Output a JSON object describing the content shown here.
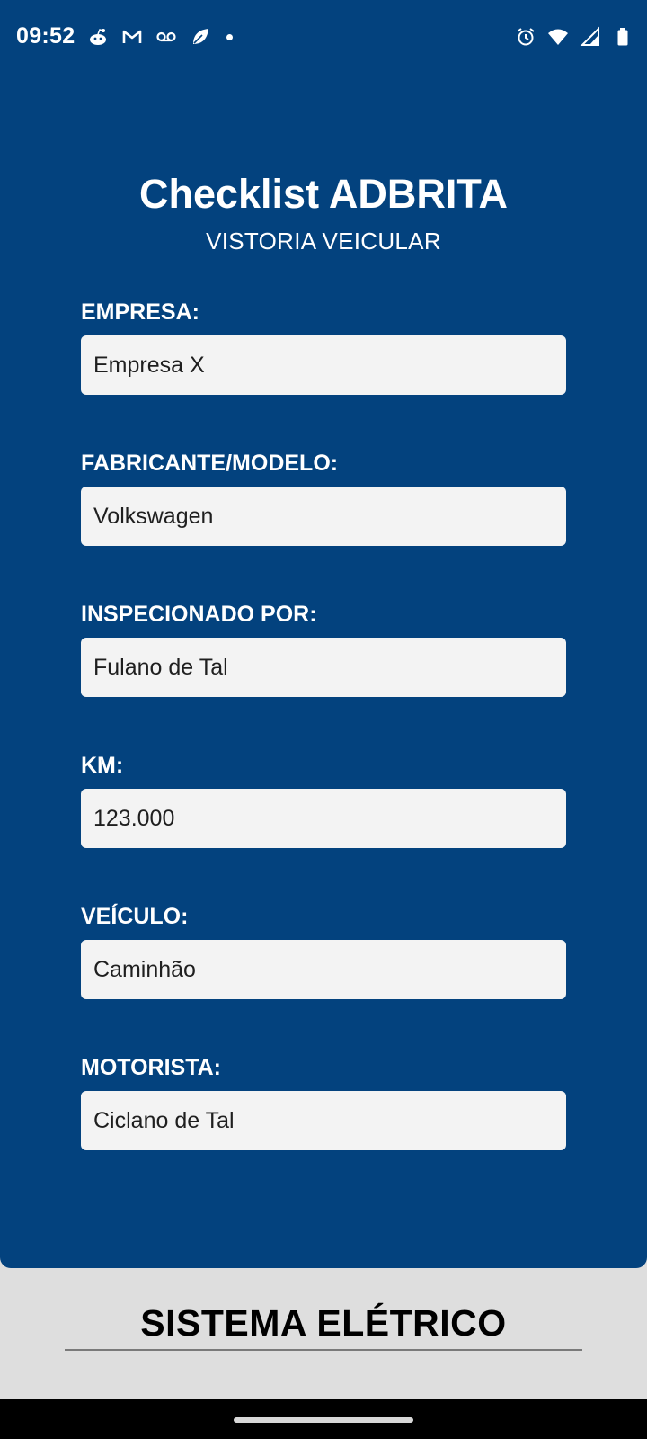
{
  "status_bar": {
    "time": "09:52",
    "left_icons": [
      "reddit-icon",
      "gmail-icon",
      "voicemail-icon",
      "leaf-icon",
      "notification-dot"
    ],
    "right_icons": [
      "alarm-icon",
      "wifi-icon",
      "signal-icon",
      "battery-icon"
    ]
  },
  "header": {
    "title": "Checklist ADBRITA",
    "subtitle": "VISTORIA VEICULAR"
  },
  "form": {
    "empresa": {
      "label": "EMPRESA:",
      "value": "Empresa X"
    },
    "fabricante": {
      "label": "FABRICANTE/MODELO:",
      "value": "Volkswagen"
    },
    "inspecionado": {
      "label": "INSPECIONADO POR:",
      "value": "Fulano de Tal"
    },
    "km": {
      "label": "KM:",
      "value": "123.000"
    },
    "veiculo": {
      "label": "VEÍCULO:",
      "value": "Caminhão"
    },
    "motorista": {
      "label": "MOTORISTA:",
      "value": "Ciclano de Tal"
    }
  },
  "section": {
    "title": "SISTEMA ELÉTRICO"
  },
  "colors": {
    "panel": "#03427e",
    "input_bg": "#f3f3f3",
    "page_bg": "#dedede"
  }
}
